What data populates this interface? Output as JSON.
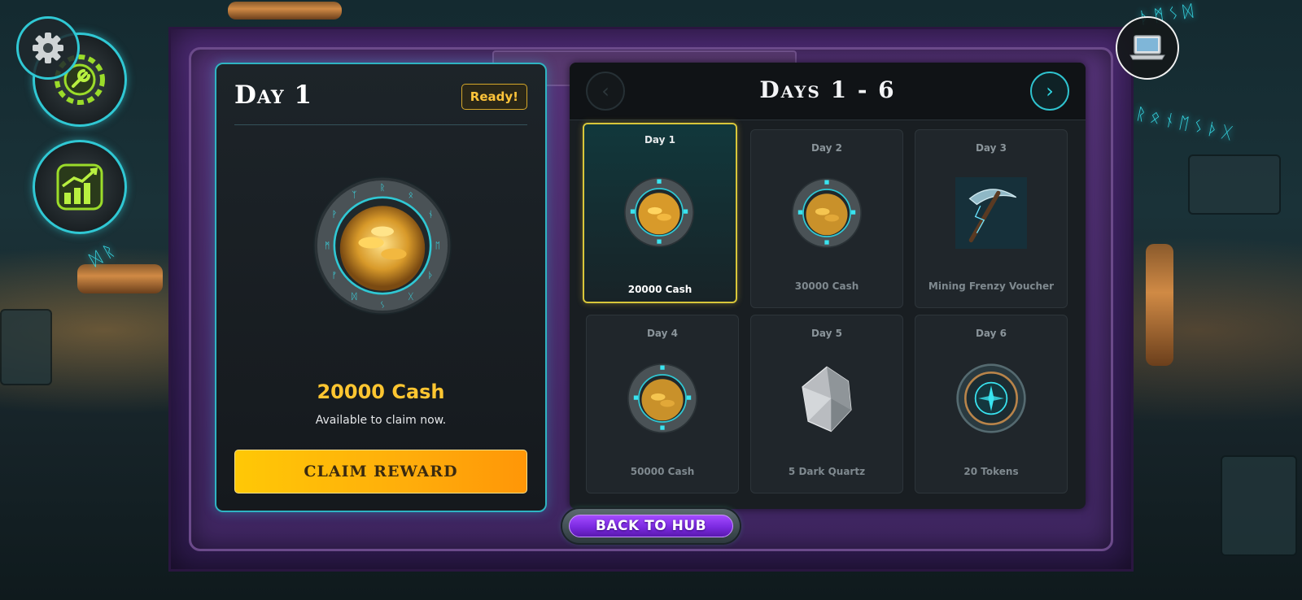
{
  "colors": {
    "accent_cyan": "#2fb4c2",
    "gold_text": "#ffc631",
    "claim_button": "#ffad0b",
    "frame_purple": "#4c2a73",
    "hub_purple": "#8a37f0"
  },
  "top_controls": {
    "settings_icon": "gear-icon",
    "tools_icon": "wrench-gear-icon",
    "stats_icon": "bar-chart-up-icon",
    "laptop_icon": "laptop-icon"
  },
  "featured": {
    "title": "Day 1",
    "badge": "Ready!",
    "icon": "coin-pile-rune-ring",
    "amount": "20000 Cash",
    "description": "Available to claim now.",
    "claim_label": "CLAIM REWARD"
  },
  "panel": {
    "heading": "Days 1 - 6",
    "prev": "‹",
    "next": "›"
  },
  "days": [
    {
      "day": "Day 1",
      "label": "20000 Cash",
      "icon": "coin-pile-rune-ring",
      "active": true
    },
    {
      "day": "Day 2",
      "label": "30000 Cash",
      "icon": "coin-pile-rune-ring",
      "active": false
    },
    {
      "day": "Day 3",
      "label": "Mining Frenzy Voucher",
      "icon": "pickaxe",
      "active": false
    },
    {
      "day": "Day 4",
      "label": "50000 Cash",
      "icon": "coin-pile-rune-ring",
      "active": false
    },
    {
      "day": "Day 5",
      "label": "5 Dark Quartz",
      "icon": "quartz-crystal",
      "active": false
    },
    {
      "day": "Day 6",
      "label": "20 Tokens",
      "icon": "rune-token",
      "active": false
    }
  ],
  "hub_button": "BACK TO HUB"
}
